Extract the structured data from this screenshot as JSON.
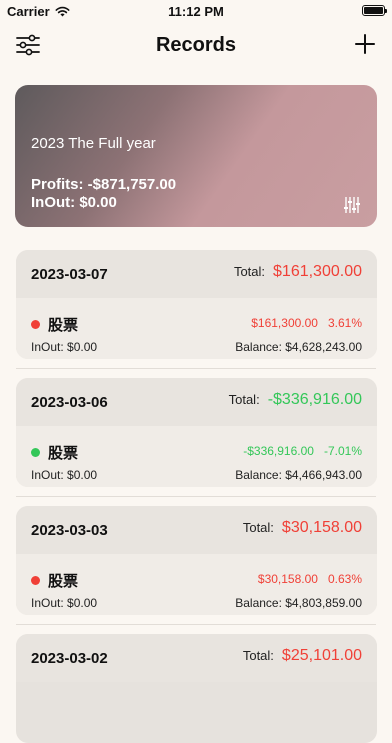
{
  "status_bar": {
    "carrier": "Carrier",
    "time": "11:12 PM"
  },
  "nav": {
    "title": "Records",
    "left_icon": "filter-sliders-icon",
    "right_icon": "plus-icon"
  },
  "summary": {
    "period": "2023 The Full year",
    "profits": "Profits: -$871,757.00",
    "inout": "InOut: $0.00",
    "settings_icon": "sliders-vertical-icon"
  },
  "colors": {
    "positive": "#f04037",
    "negative": "#34c759"
  },
  "records": [
    {
      "date": "2023-03-07",
      "total_label": "Total:",
      "total": "$161,300.00",
      "trend": "up",
      "name": "股票",
      "pl": "$161,300.00",
      "pct": "3.61%",
      "inout": "InOut: $0.00",
      "balance": "Balance: $4,628,243.00"
    },
    {
      "date": "2023-03-06",
      "total_label": "Total:",
      "total": "-$336,916.00",
      "trend": "down",
      "name": "股票",
      "pl": "-$336,916.00",
      "pct": "-7.01%",
      "inout": "InOut: $0.00",
      "balance": "Balance: $4,466,943.00"
    },
    {
      "date": "2023-03-03",
      "total_label": "Total:",
      "total": "$30,158.00",
      "trend": "up",
      "name": "股票",
      "pl": "$30,158.00",
      "pct": "0.63%",
      "inout": "InOut: $0.00",
      "balance": "Balance: $4,803,859.00"
    },
    {
      "date": "2023-03-02",
      "total_label": "Total:",
      "total": "$25,101.00",
      "trend": "up"
    }
  ]
}
